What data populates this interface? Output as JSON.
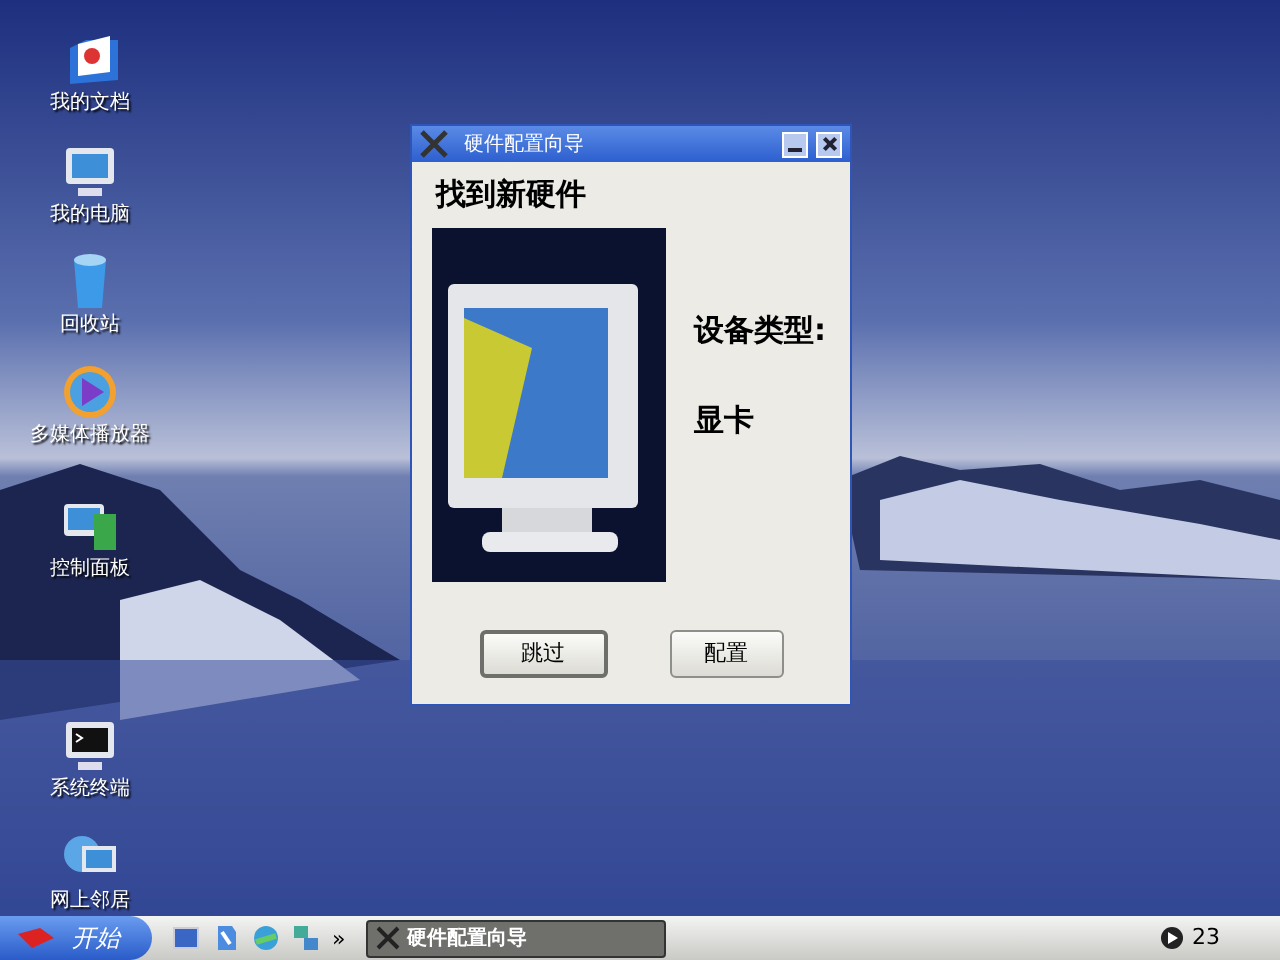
{
  "desktop_icons": [
    {
      "label": "我的文档"
    },
    {
      "label": "我的电脑"
    },
    {
      "label": "回收站"
    },
    {
      "label": "多媒体播放器"
    },
    {
      "label": "控制面板"
    },
    {
      "label": "系统终端"
    },
    {
      "label": "网上邻居"
    }
  ],
  "window": {
    "title": "硬件配置向导",
    "heading": "找到新硬件",
    "device_type_label": "设备类型:",
    "device_type": "显卡",
    "buttons": [
      {
        "label": "跳过",
        "selected": true
      },
      {
        "label": "配置",
        "selected": false
      }
    ]
  },
  "taskbar": {
    "start": "开始",
    "more": "»",
    "tasks": [
      {
        "label": "硬件配置向导",
        "selected": true
      }
    ],
    "clock": "23"
  }
}
